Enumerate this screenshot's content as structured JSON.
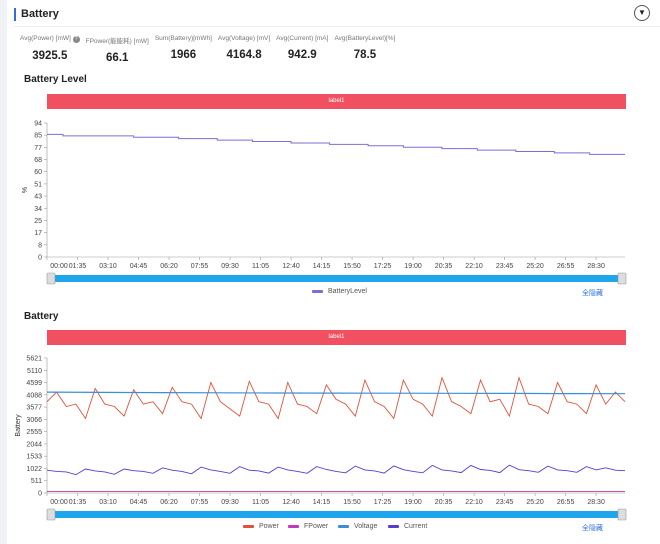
{
  "header": {
    "title": "Battery",
    "collapse_icon": "chevron-down-icon"
  },
  "stats": [
    {
      "label": "Avg(Power) [mW]",
      "value": "3925.5",
      "info": true
    },
    {
      "label": "FPower(能能耗) [mW]",
      "value": "66.1"
    },
    {
      "label": "Sum(Battery)[mWh]",
      "value": "1966"
    },
    {
      "label": "Avg(Voltage) [mV]",
      "value": "4164.8"
    },
    {
      "label": "Avg(Current) [mA]",
      "value": "942.9"
    },
    {
      "label": "Avg(BatteryLevel)[%]",
      "value": "78.5"
    }
  ],
  "hide_all": "全隐藏",
  "chart_data": [
    {
      "type": "line",
      "title": "Battery Level",
      "banner": "label1",
      "ylabel": "%",
      "ylim": [
        0,
        94
      ],
      "yticks": [
        "0",
        "8",
        "17",
        "25",
        "34",
        "43",
        "51",
        "60",
        "68",
        "77",
        "85",
        "94"
      ],
      "xticks": [
        "00:00",
        "01:35",
        "03:10",
        "04:45",
        "06:20",
        "07:55",
        "09:30",
        "11:05",
        "12:40",
        "14:15",
        "15:50",
        "17:25",
        "19:00",
        "20:35",
        "22:10",
        "23:45",
        "25:20",
        "26:55",
        "28:30"
      ],
      "x_range_seconds": [
        0,
        1800
      ],
      "series": [
        {
          "name": "BatteryLevel",
          "color": "#7b6fd6",
          "steps": [
            [
              0,
              86
            ],
            [
              50,
              85
            ],
            [
              170,
              85
            ],
            [
              270,
              84
            ],
            [
              410,
              83
            ],
            [
              530,
              82
            ],
            [
              640,
              81
            ],
            [
              760,
              80
            ],
            [
              880,
              79
            ],
            [
              1000,
              78
            ],
            [
              1110,
              77
            ],
            [
              1230,
              76
            ],
            [
              1340,
              75
            ],
            [
              1460,
              74
            ],
            [
              1580,
              73
            ],
            [
              1690,
              72
            ],
            [
              1800,
              72
            ]
          ]
        }
      ]
    },
    {
      "type": "line",
      "title": "Battery",
      "banner": "label1",
      "ylabel": "Battery",
      "ylim": [
        0,
        5621
      ],
      "yticks": [
        "0",
        "511",
        "1022",
        "1533",
        "2044",
        "2555",
        "3066",
        "3577",
        "4088",
        "4599",
        "5110",
        "5621"
      ],
      "xticks": [
        "00:00",
        "01:35",
        "03:10",
        "04:45",
        "06:20",
        "07:55",
        "09:30",
        "11:05",
        "12:40",
        "14:15",
        "15:50",
        "17:25",
        "19:00",
        "20:35",
        "22:10",
        "23:45",
        "25:20",
        "26:55",
        "28:30"
      ],
      "x_step_seconds": 30,
      "series": [
        {
          "name": "Power",
          "color": "#e0533a",
          "values": [
            3800,
            4200,
            3600,
            3700,
            3100,
            4350,
            3700,
            3600,
            3200,
            4300,
            3700,
            3800,
            3300,
            4400,
            3800,
            3700,
            3100,
            4600,
            3800,
            3500,
            3200,
            4650,
            3800,
            3700,
            3100,
            4600,
            3700,
            3600,
            3300,
            4500,
            3900,
            3700,
            3200,
            4700,
            3800,
            3600,
            3100,
            4700,
            3900,
            3700,
            3200,
            4800,
            3800,
            3600,
            3300,
            4700,
            3800,
            3900,
            3200,
            4800,
            3700,
            3600,
            3300,
            4600,
            3800,
            3700,
            3300,
            4500,
            3700,
            4200,
            3800
          ]
        },
        {
          "name": "FPower",
          "color": "#c23ab6",
          "values": [
            66,
            66,
            66,
            66,
            66,
            66,
            66,
            66,
            66,
            66,
            66
          ]
        },
        {
          "name": "Voltage",
          "color": "#3a8fd8",
          "values": [
            4200,
            4190,
            4180,
            4170,
            4165,
            4160,
            4155,
            4150,
            4145,
            4140,
            4135
          ]
        },
        {
          "name": "Current",
          "color": "#5a3bd0",
          "values": [
            950,
            900,
            880,
            760,
            1000,
            920,
            880,
            780,
            1000,
            930,
            900,
            820,
            1050,
            950,
            900,
            800,
            1080,
            960,
            900,
            820,
            1100,
            950,
            920,
            830,
            1080,
            960,
            900,
            820,
            1100,
            980,
            900,
            840,
            1120,
            960,
            920,
            830,
            1130,
            970,
            900,
            840,
            1150,
            960,
            920,
            850,
            1150,
            980,
            940,
            850,
            1160,
            970,
            930,
            860,
            1120,
            960,
            930,
            860,
            1100,
            960,
            1050,
            950,
            930
          ]
        }
      ]
    }
  ]
}
